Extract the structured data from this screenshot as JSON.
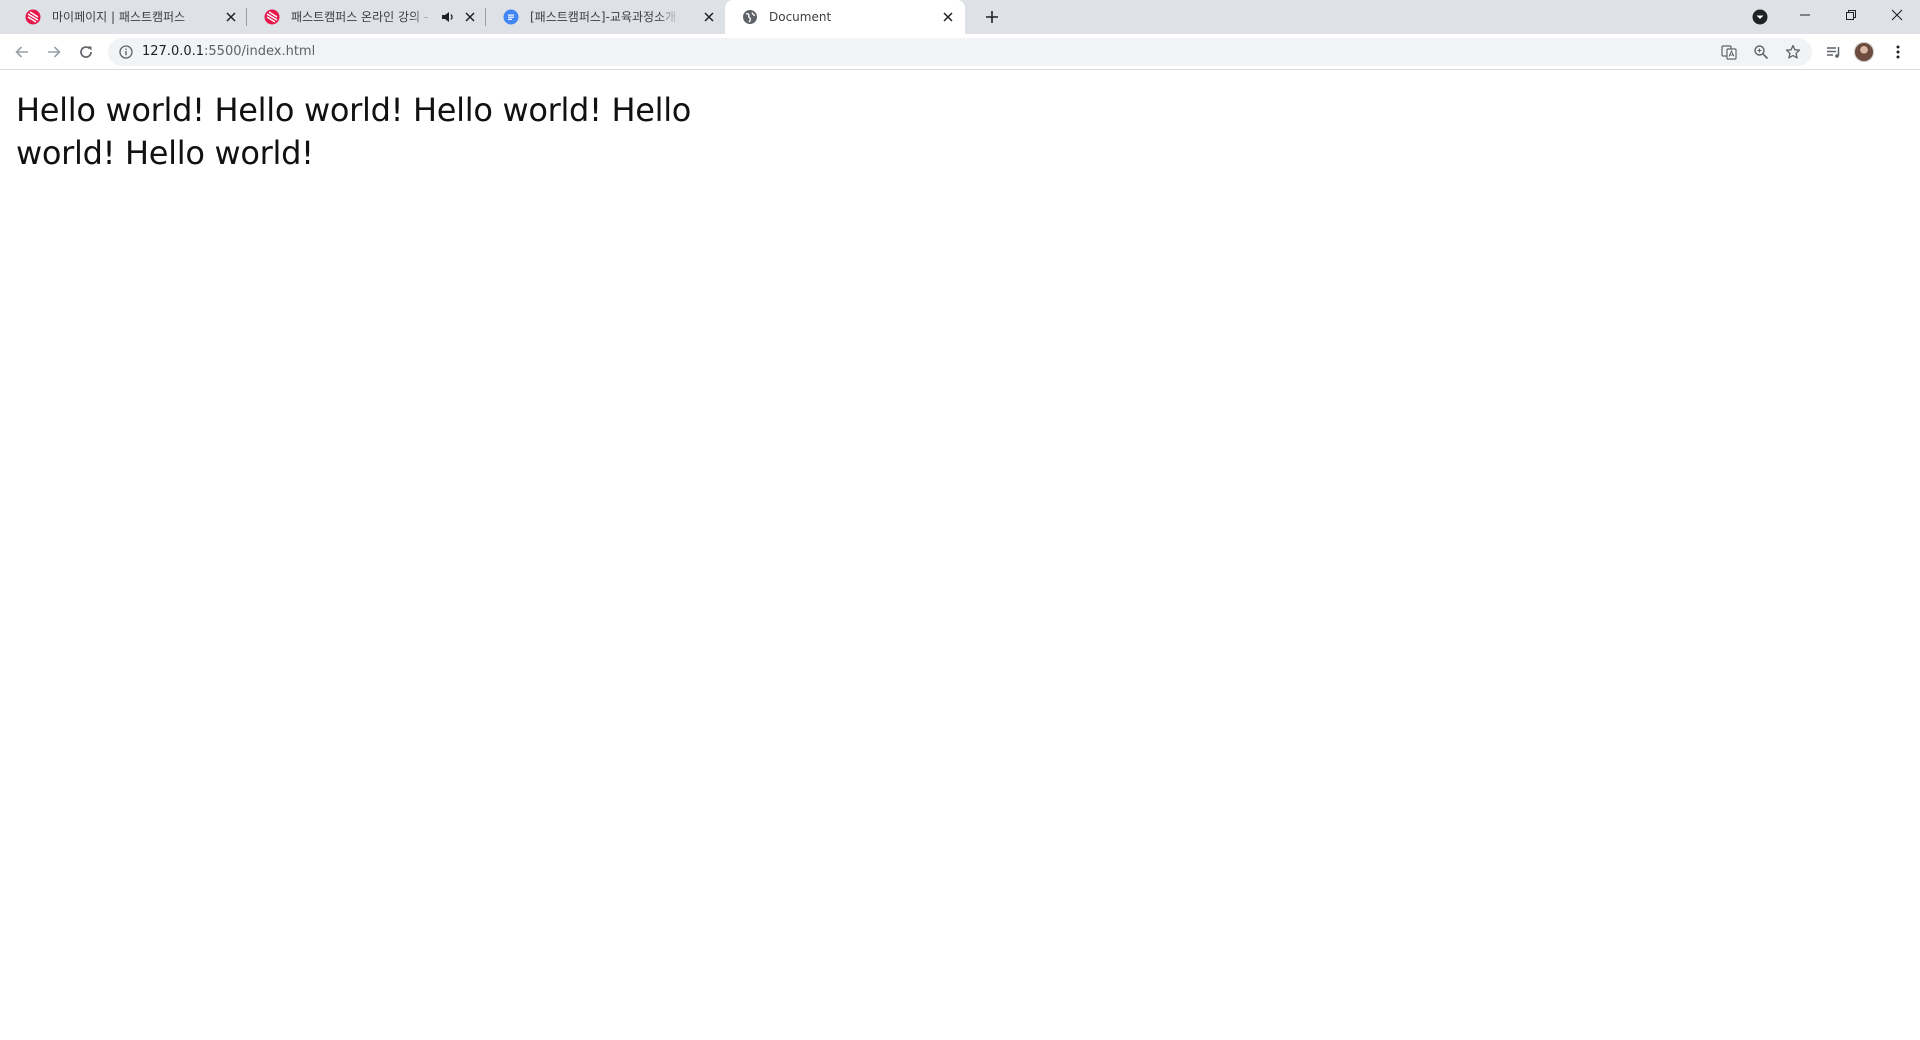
{
  "browser": {
    "tabs": [
      {
        "title": "마이페이지 | 패스트캠퍼스",
        "favicon": "fastcampus-logo-icon",
        "active": false,
        "audio": false
      },
      {
        "title": "패스트캠퍼스 온라인 강의 - ",
        "favicon": "fastcampus-logo-icon",
        "active": false,
        "audio": true
      },
      {
        "title": "[패스트캠퍼스]-교육과정소개서-",
        "favicon": "google-docs-icon",
        "active": false,
        "audio": false
      },
      {
        "title": "Document",
        "favicon": "globe-icon",
        "active": true,
        "audio": false
      }
    ],
    "address": {
      "host": "127.0.0.1",
      "rest": ":5500/index.html"
    },
    "colors": {
      "tabstrip_bg": "#dee1e6",
      "omnibox_bg": "#f1f3f4",
      "fastcampus_brand": "#e5174b",
      "docs_blue": "#4285f4"
    }
  },
  "page": {
    "text": "Hello world! Hello world! Hello world! Hello world! Hello world!"
  }
}
